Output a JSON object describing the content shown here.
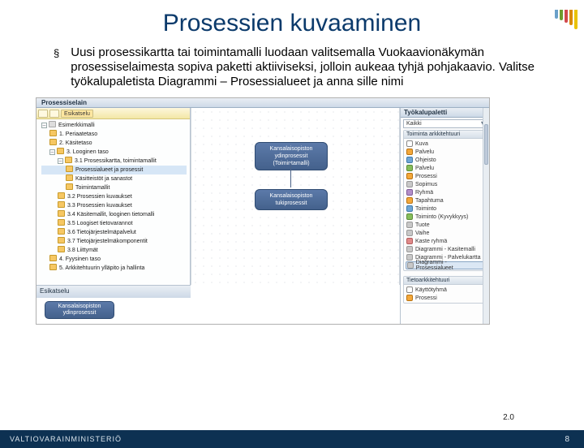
{
  "header": {
    "title": "Prosessien kuvaaminen"
  },
  "bullet": {
    "mark": "§",
    "text": "Uusi prosessikartta tai toimintamalli luodaan valitsemalla Vuokaavionäkymän prosessiselaimesta sopiva paketti aktiiviseksi, jolloin aukeaa tyhjä pohjakaavio. Valitse työkalupaletista Diagrammi – Prosessialueet ja anna sille nimi"
  },
  "browser": {
    "title": "Prosessiselain",
    "previewBtn": "Esikatselu",
    "preview_label": "Esikatselu",
    "tree": [
      {
        "lvl": 0,
        "icon": "g",
        "label": "Esimerkkimalli",
        "exp": "-"
      },
      {
        "lvl": 1,
        "icon": "o",
        "label": "1. Periaatetaso"
      },
      {
        "lvl": 1,
        "icon": "o",
        "label": "2. Käsitetaso"
      },
      {
        "lvl": 1,
        "icon": "o",
        "label": "3. Looginen taso",
        "exp": "-"
      },
      {
        "lvl": 2,
        "icon": "o",
        "label": "3.1 Prosessikartta, toimintamallit",
        "exp": "-"
      },
      {
        "lvl": 3,
        "icon": "o",
        "label": "Prosessialueet ja prosessit",
        "sel": true
      },
      {
        "lvl": 3,
        "icon": "o",
        "label": "Käsitteistöt ja sanastot"
      },
      {
        "lvl": 3,
        "icon": "o",
        "label": "Toimintamallit"
      },
      {
        "lvl": 2,
        "icon": "o",
        "label": "3.2 Prosessien kuvaukset"
      },
      {
        "lvl": 2,
        "icon": "o",
        "label": "3.3 Prosessien kuvaukset"
      },
      {
        "lvl": 2,
        "icon": "o",
        "label": "3.4 Käsitemallit, looginen tietomalli"
      },
      {
        "lvl": 2,
        "icon": "o",
        "label": "3.5 Loogiset tietovarannot"
      },
      {
        "lvl": 2,
        "icon": "o",
        "label": "3.6 Tietojärjestelmäpalvelut"
      },
      {
        "lvl": 2,
        "icon": "o",
        "label": "3.7 Tietojärjestelmäkomponentit"
      },
      {
        "lvl": 2,
        "icon": "o",
        "label": "3.8 Liittymät"
      },
      {
        "lvl": 1,
        "icon": "o",
        "label": "4. Fyysinen taso"
      },
      {
        "lvl": 1,
        "icon": "o",
        "label": "5. Arkkitehtuurin ylläpito ja hallinta"
      }
    ],
    "nodes": {
      "a": "Kansalaisopiston ydinprosessit (Toimintamalli)",
      "b": "Kansalaisopiston tukiprosessit"
    },
    "pnode": "Kansalaisopiston ydinprosessit"
  },
  "palette": {
    "title": "Työkalupaletti",
    "dropdown": "Kaikki",
    "group1": {
      "title": "Toiminta arkkitehtuuri",
      "items": [
        {
          "c": "sq",
          "l": "Kuva"
        },
        {
          "c": "og",
          "l": "Palvelu"
        },
        {
          "c": "bl",
          "l": "Ohjeisto"
        },
        {
          "c": "gr",
          "l": "Palvelu"
        },
        {
          "c": "og",
          "l": "Prosessi"
        },
        {
          "c": "gs",
          "l": "Sopimus"
        },
        {
          "c": "pu",
          "l": "Ryhmä"
        },
        {
          "c": "og",
          "l": "Tapahtuma"
        },
        {
          "c": "bl",
          "l": "Toiminto"
        },
        {
          "c": "gr",
          "l": "Toiminto (Kyvykkyys)"
        },
        {
          "c": "gs",
          "l": "Tuote"
        },
        {
          "c": "gs",
          "l": "Vaihe"
        },
        {
          "c": "rd",
          "l": "Kaste ryhmä"
        },
        {
          "c": "gs",
          "l": "Diagrammi - Kasitemalli"
        },
        {
          "c": "gs",
          "l": "Diagrammi - Palvelukartta"
        },
        {
          "c": "gs",
          "l": "Diagrammi - Prosessialueet",
          "sel": true
        }
      ]
    },
    "group2": {
      "title": "Tietoarkkitehtuuri",
      "items": [
        {
          "c": "sq",
          "l": "Käyttötyhmä"
        },
        {
          "c": "og",
          "l": "Prosessi"
        }
      ]
    }
  },
  "footer": {
    "org": "VALTIOVARAINMINISTERIÖ",
    "version": "2.0",
    "page": "8"
  }
}
